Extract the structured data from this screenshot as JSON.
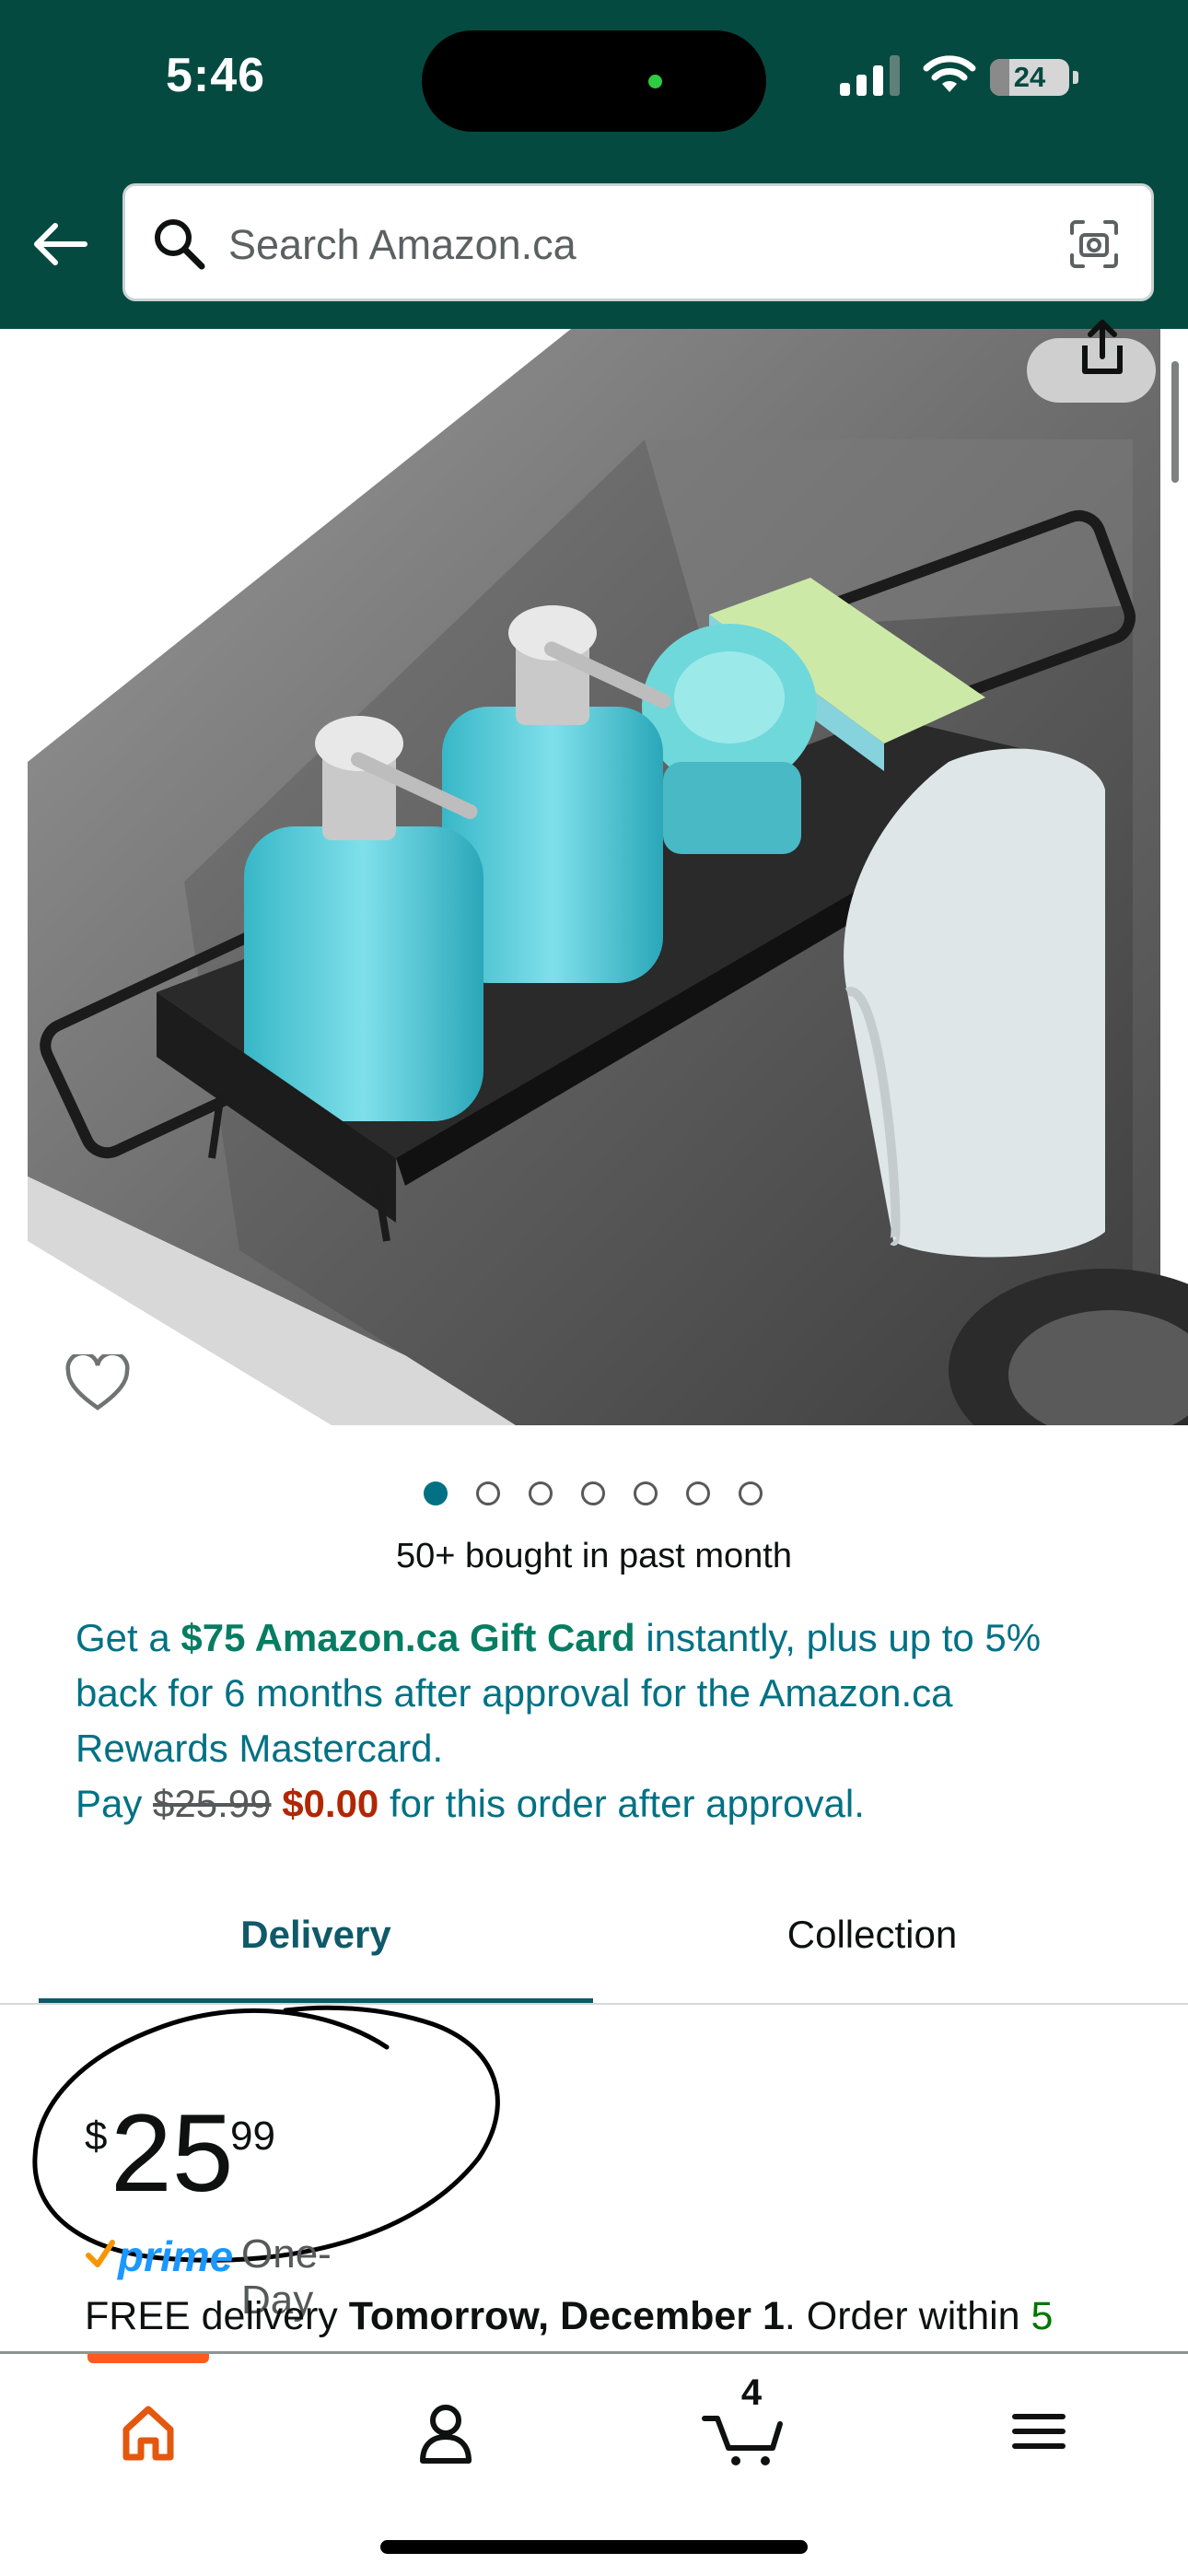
{
  "status_bar": {
    "time": "5:46",
    "battery_level": "24",
    "signal_icon": "signal-icon",
    "wifi_icon": "wifi-icon"
  },
  "header": {
    "back_icon": "back-arrow-icon",
    "search": {
      "placeholder": "Search Amazon.ca",
      "value": ""
    },
    "camera_icon": "camera-scan-icon"
  },
  "product": {
    "image_icons": [
      "share-icon",
      "heart-icon"
    ],
    "carousel": {
      "count": 7,
      "active_index": 0
    },
    "bought_text": "50+ bought in past month"
  },
  "promo": {
    "prefix": "Get a ",
    "gift_card": "$75 Amazon.ca Gift Card",
    "line1_rest": " instantly, plus up to 5% back for 6 months after approval for the Amazon.ca Rewards Mastercard.",
    "pay_label": "Pay ",
    "old_price": "$25.99",
    "new_price": "$0.00",
    "pay_suffix": " for this order after approval."
  },
  "tabs": [
    {
      "label": "Delivery",
      "active": true
    },
    {
      "label": "Collection",
      "active": false
    }
  ],
  "price": {
    "symbol": "$",
    "whole": "25",
    "fraction": "99"
  },
  "shipping": {
    "prime_label": "prime",
    "prime_type": "One-Day",
    "free_delivery": "FREE delivery ",
    "date": "Tomorrow, December 1",
    "order_within": ". Order within ",
    "countdown": "5"
  },
  "bottom_nav": {
    "items": [
      "home-icon",
      "account-icon",
      "cart-icon",
      "menu-icon"
    ],
    "cart_count": "4"
  },
  "colors": {
    "header_bg": "#054a40",
    "link_teal": "#007185",
    "green": "#067d62",
    "red": "#b12704",
    "active_orange": "#ff5a1f"
  }
}
